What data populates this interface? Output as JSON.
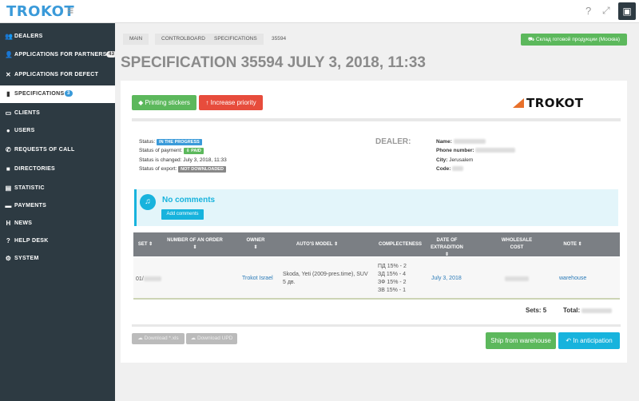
{
  "topbar": {
    "logo": "TROKOT",
    "menu_icon": "hamburger-icon",
    "help": "?",
    "expand_icon": "expand-icon"
  },
  "sidebar": {
    "items": [
      {
        "label": "DEALERS",
        "icon": "users-icon",
        "glyph": "👥"
      },
      {
        "label": "APPLICATIONS FOR PARTNERSHIP",
        "icon": "user-add-icon",
        "glyph": "👤",
        "badge": "43"
      },
      {
        "label": "APPLICATIONS FOR DEFECT",
        "icon": "close-icon",
        "glyph": "✕"
      },
      {
        "label": "SPECIFICATIONS",
        "icon": "document-icon",
        "glyph": "▮",
        "badge": "3",
        "active": true
      },
      {
        "label": "CLIENTS",
        "icon": "id-card-icon",
        "glyph": "▭"
      },
      {
        "label": "USERS",
        "icon": "user-icon",
        "glyph": "●"
      },
      {
        "label": "REQUESTS OF CALL",
        "icon": "phone-icon",
        "glyph": "✆"
      },
      {
        "label": "DIRECTORIES",
        "icon": "folder-icon",
        "glyph": "■"
      },
      {
        "label": "STATISTIC",
        "icon": "chart-icon",
        "glyph": "▤"
      },
      {
        "label": "PAYMENTS",
        "icon": "card-icon",
        "glyph": "▬"
      },
      {
        "label": "NEWS",
        "icon": "news-icon",
        "glyph": "H"
      },
      {
        "label": "HELP DESK",
        "icon": "question-icon",
        "glyph": "?"
      },
      {
        "label": "SYSTEM",
        "icon": "gears-icon",
        "glyph": "⚙"
      }
    ]
  },
  "breadcrumb": {
    "items": [
      "MAIN",
      "CONTROLBOARD",
      "SPECIFICATIONS"
    ],
    "current": "35594"
  },
  "warehouse_button": "Склад готовой продукции (Москва)",
  "page_title": "SPECIFICATION 35594  JULY 3, 2018, 11:33",
  "actions": {
    "print_stickers": "Printing stickers",
    "increase_priority": "Increase priority"
  },
  "brand": "TROKOT",
  "status": {
    "status_label": "Status:",
    "status_value": "IN THE PROGRESS",
    "payment_label": "Status of payment:",
    "payment_value": "Paid",
    "changed_label": "Status is changed:",
    "changed_value": "July 3, 2018, 11:33",
    "export_label": "Status of export:",
    "export_value": "NOT DOWNLOADED"
  },
  "dealer": {
    "heading": "DEALER:",
    "name_label": "Name:",
    "phone_label": "Phone number:",
    "city_label": "City:",
    "city_value": "Jerusalem",
    "code_label": "Code:"
  },
  "comments": {
    "empty_text": "No comments",
    "add_button": "Add comments"
  },
  "table": {
    "headers": [
      "SET",
      "NUMBER OF AN ORDER",
      "OWNER",
      "AUTO'S MODEL",
      "COMPLECTENESS",
      "DATE OF EXTRADITION",
      "WHOLESALE COST",
      "NOTE"
    ],
    "rows": [
      {
        "set": "01/",
        "owner": "Trokot Israel",
        "model": "Skoda, Yeti (2009-pres.time), SUV 5 дв.",
        "completeness": [
          "ПД 15% - 2",
          "ЗД 15% - 4",
          "ЗФ 15% - 2",
          "ЗВ 15% - 1"
        ],
        "date": "July 3, 2018",
        "note": "warehouse"
      }
    ]
  },
  "totals": {
    "sets_label": "Sets:",
    "sets_value": "5",
    "total_label": "Total:"
  },
  "footer": {
    "download_xls": "Download *.xls",
    "download_upd": "Download UPD",
    "ship": "Ship from warehouse",
    "anticipation": "In anticipation"
  }
}
